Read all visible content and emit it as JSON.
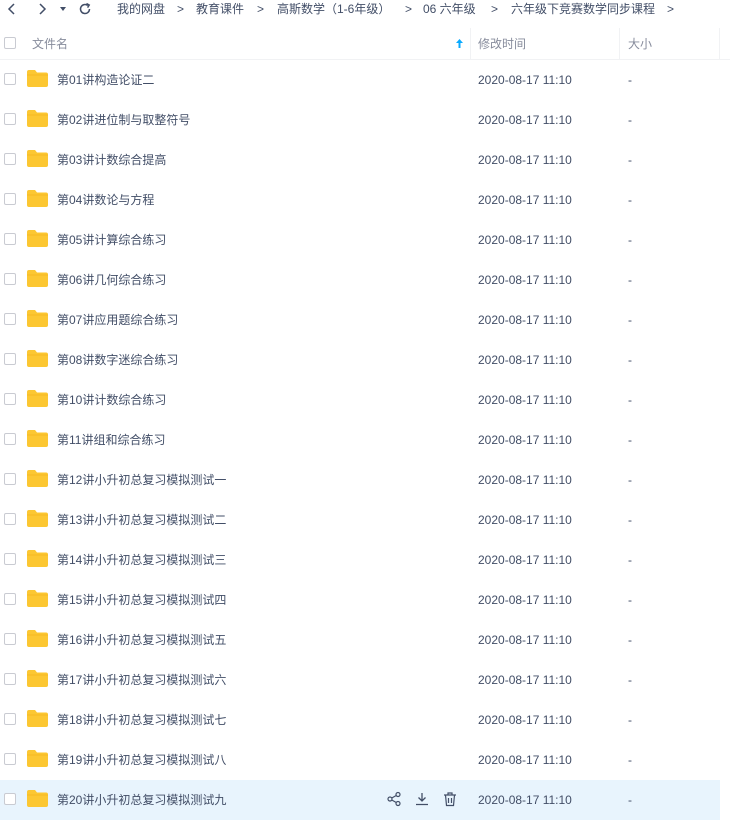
{
  "toolbar": {
    "back_icon": "chevron-left-icon",
    "forward_icon": "chevron-right-icon",
    "history_icon": "caret-down-icon",
    "refresh_icon": "refresh-icon",
    "breadcrumb": [
      "我的网盘",
      "教育课件",
      "高斯数学（1-6年级）",
      "06 六年级",
      "六年级下竞赛数学同步课程"
    ],
    "separator": ">"
  },
  "header": {
    "name_label": "文件名",
    "modified_label": "修改时间",
    "size_label": "大小",
    "sort_icon": "sort-arrow-up-icon"
  },
  "files": [
    {
      "name": "第01讲构造论证二",
      "modified": "2020-08-17 11:10",
      "size": "-"
    },
    {
      "name": "第02讲进位制与取整符号",
      "modified": "2020-08-17 11:10",
      "size": "-"
    },
    {
      "name": "第03讲计数综合提高",
      "modified": "2020-08-17 11:10",
      "size": "-"
    },
    {
      "name": "第04讲数论与方程",
      "modified": "2020-08-17 11:10",
      "size": "-"
    },
    {
      "name": "第05讲计算综合练习",
      "modified": "2020-08-17 11:10",
      "size": "-"
    },
    {
      "name": "第06讲几何综合练习",
      "modified": "2020-08-17 11:10",
      "size": "-"
    },
    {
      "name": "第07讲应用题综合练习",
      "modified": "2020-08-17 11:10",
      "size": "-"
    },
    {
      "name": "第08讲数字迷综合练习",
      "modified": "2020-08-17 11:10",
      "size": "-"
    },
    {
      "name": "第10讲计数综合练习",
      "modified": "2020-08-17 11:10",
      "size": "-"
    },
    {
      "name": "第11讲组和综合练习",
      "modified": "2020-08-17 11:10",
      "size": "-"
    },
    {
      "name": "第12讲小升初总复习模拟测试一",
      "modified": "2020-08-17 11:10",
      "size": "-"
    },
    {
      "name": "第13讲小升初总复习模拟测试二",
      "modified": "2020-08-17 11:10",
      "size": "-"
    },
    {
      "name": "第14讲小升初总复习模拟测试三",
      "modified": "2020-08-17 11:10",
      "size": "-"
    },
    {
      "name": "第15讲小升初总复习模拟测试四",
      "modified": "2020-08-17 11:10",
      "size": "-"
    },
    {
      "name": "第16讲小升初总复习模拟测试五",
      "modified": "2020-08-17 11:10",
      "size": "-"
    },
    {
      "name": "第17讲小升初总复习模拟测试六",
      "modified": "2020-08-17 11:10",
      "size": "-"
    },
    {
      "name": "第18讲小升初总复习模拟测试七",
      "modified": "2020-08-17 11:10",
      "size": "-"
    },
    {
      "name": "第19讲小升初总复习模拟测试八",
      "modified": "2020-08-17 11:10",
      "size": "-"
    },
    {
      "name": "第20讲小升初总复习模拟测试九",
      "modified": "2020-08-17 11:10",
      "size": "-"
    }
  ],
  "hovered_row": 18,
  "row_actions": [
    "share-icon",
    "download-icon",
    "delete-icon"
  ],
  "colors": {
    "folder": "#fcc732",
    "hover_row": "#e8f4fd",
    "sort_arrow": "#09aaff",
    "text": "#424e67",
    "muted": "#878c9c"
  }
}
